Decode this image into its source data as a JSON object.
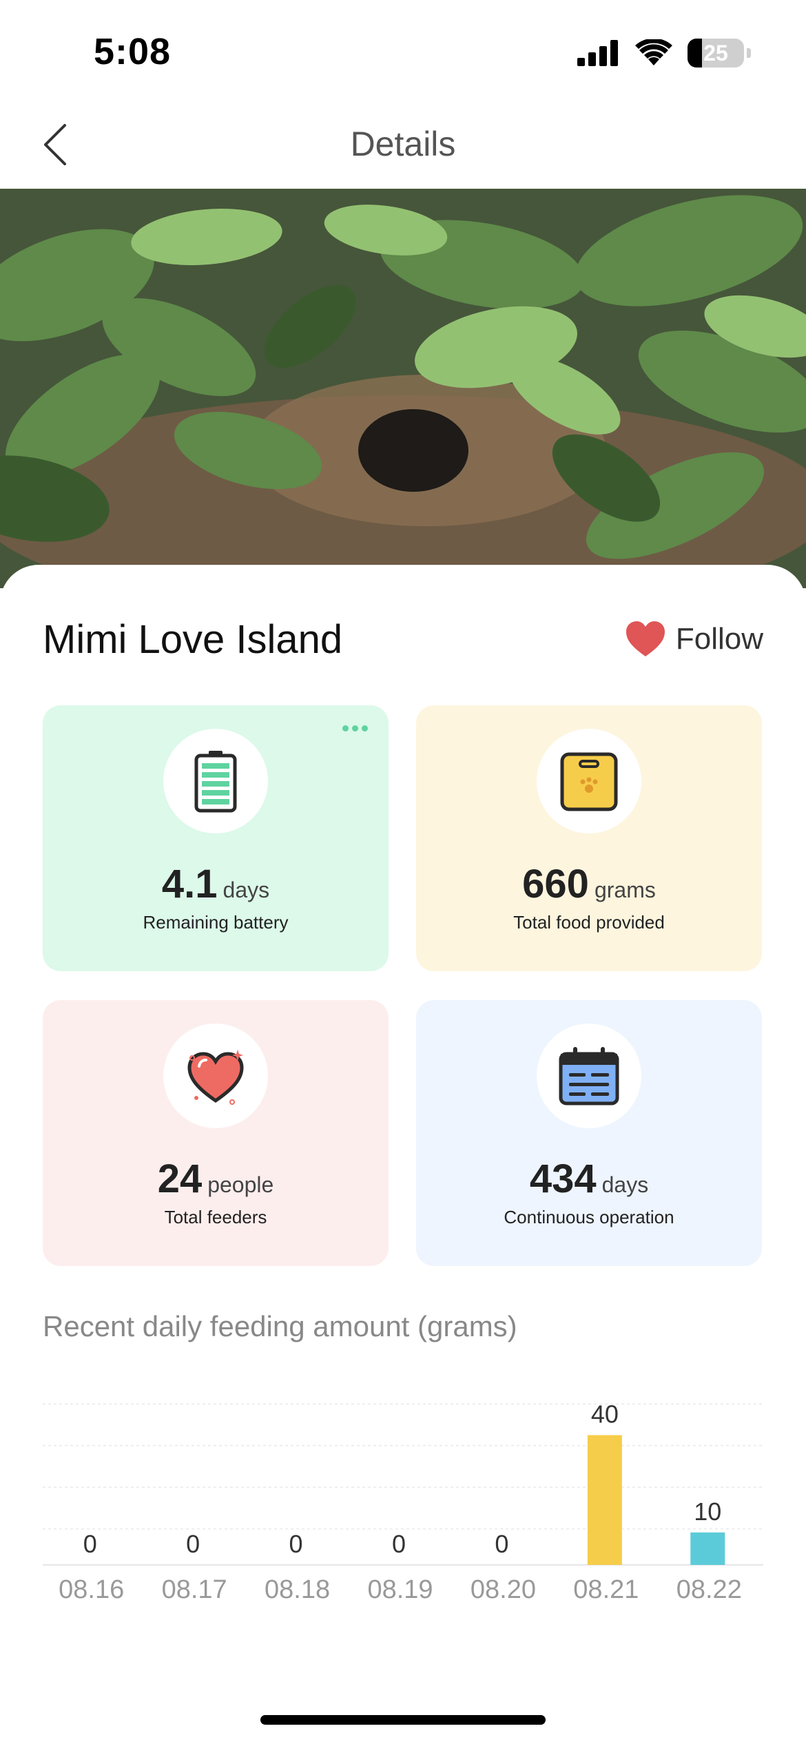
{
  "status_bar": {
    "time": "5:08",
    "battery_level": "25"
  },
  "nav": {
    "title": "Details",
    "back_icon": "chevron-left-icon"
  },
  "location": {
    "name": "Mimi Love Island",
    "follow_label": "Follow",
    "follow_icon": "heart-icon"
  },
  "stats": [
    {
      "value": "4.1",
      "unit": "days",
      "label": "Remaining battery",
      "icon": "battery-icon",
      "bg": "#dcf9ea"
    },
    {
      "value": "660",
      "unit": "grams",
      "label": "Total food provided",
      "icon": "food-bag-icon",
      "bg": "#fdf5de"
    },
    {
      "value": "24",
      "unit": "people",
      "label": "Total feeders",
      "icon": "heart-icon",
      "bg": "#fdeeee"
    },
    {
      "value": "434",
      "unit": "days",
      "label": "Continuous operation",
      "icon": "calendar-icon",
      "bg": "#eef5fe"
    }
  ],
  "chart_title": "Recent daily feeding amount (grams)",
  "chart_data": {
    "type": "bar",
    "title": "Recent daily feeding amount (grams)",
    "categories": [
      "08.16",
      "08.17",
      "08.18",
      "08.19",
      "08.20",
      "08.21",
      "08.22"
    ],
    "values": [
      0,
      0,
      0,
      0,
      0,
      40,
      10
    ],
    "colors": [
      "#f6cd4a",
      "#f6cd4a",
      "#f6cd4a",
      "#f6cd4a",
      "#f6cd4a",
      "#f6cd4a",
      "#5ccbd9"
    ],
    "ylim": [
      0,
      50
    ],
    "grid": true
  }
}
